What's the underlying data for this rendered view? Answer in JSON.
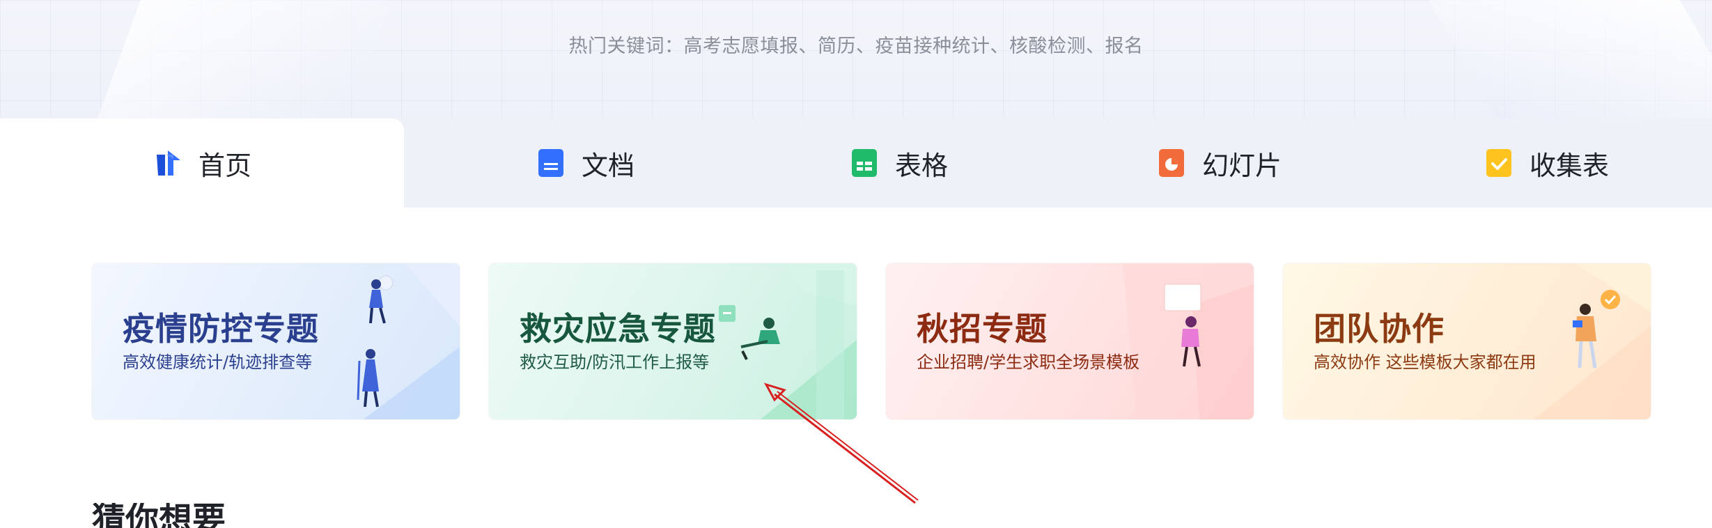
{
  "hero": {
    "hot_keywords": "热门关键词：高考志愿填报、简历、疫苗接种统计、核酸检测、报名"
  },
  "tabs": [
    {
      "label": "首页",
      "icon": "home-icon",
      "active": true
    },
    {
      "label": "文档",
      "icon": "doc-icon",
      "color": "#3370ff"
    },
    {
      "label": "表格",
      "icon": "sheet-icon",
      "color": "#1fbb6b"
    },
    {
      "label": "幻灯片",
      "icon": "slides-icon",
      "color": "#f26b3a"
    },
    {
      "label": "收集表",
      "icon": "form-icon",
      "color": "#ffc31f"
    }
  ],
  "banners": [
    {
      "title": "疫情防控专题",
      "subtitle": "高效健康统计/轨迹排查等"
    },
    {
      "title": "救灾应急专题",
      "subtitle": "救灾互助/防汛工作上报等"
    },
    {
      "title": "秋招专题",
      "subtitle": "企业招聘/学生求职全场景模板"
    },
    {
      "title": "团队协作",
      "subtitle": "高效协作 这些模板大家都在用"
    }
  ],
  "section": {
    "title": "猜你想要"
  },
  "colors": {
    "accent_blue": "#3370ff",
    "annotation_arrow": "#d92020"
  }
}
